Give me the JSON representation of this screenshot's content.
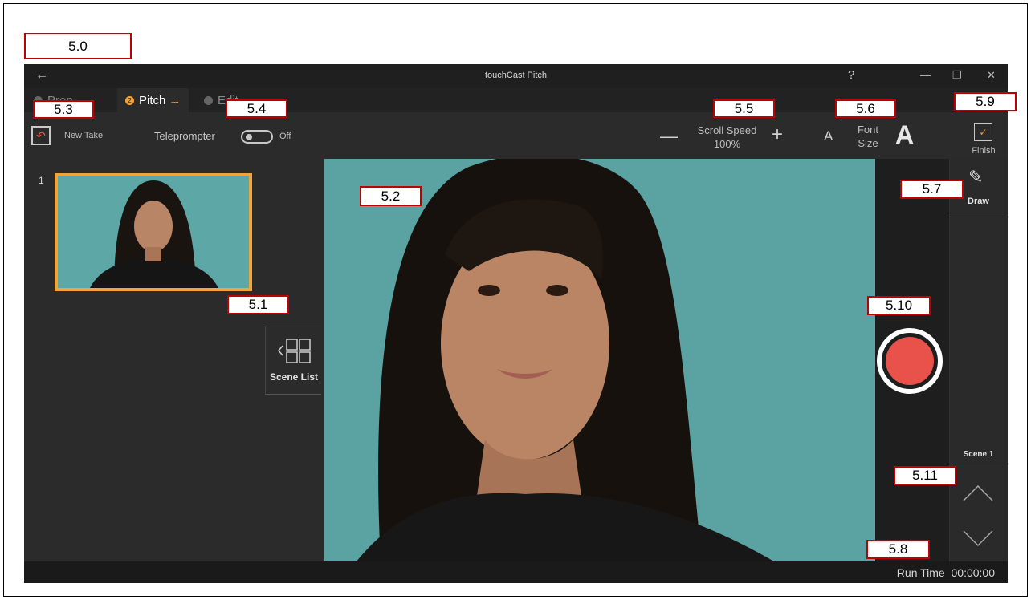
{
  "window": {
    "title": "touchCast Pitch",
    "help_label": "?",
    "back_icon": "back-arrow-icon"
  },
  "steps": [
    {
      "index": "1",
      "label": "Prep",
      "arrow": "→"
    },
    {
      "index": "2",
      "label": "Pitch",
      "arrow": "→"
    },
    {
      "index": "3",
      "label": "Edit",
      "arrow": ""
    }
  ],
  "toolbar": {
    "new_take_label": "New Take",
    "teleprompter_label": "Teleprompter",
    "teleprompter_state": "Off",
    "minus_label": "—",
    "scroll_speed_label": "Scroll Speed",
    "scroll_speed_value": "100%",
    "plus_label": "+",
    "font_small_label": "A",
    "font_size_line1": "Font",
    "font_size_line2": "Size",
    "font_large_label": "A",
    "finish_label": "Finish"
  },
  "scenes": {
    "items": [
      {
        "number": "1"
      }
    ],
    "scene_list_label": "Scene List"
  },
  "right_panel": {
    "draw_label": "Draw",
    "scene_label": "Scene 1"
  },
  "status": {
    "run_time_label": "Run Time",
    "run_time_value": "00:00:00"
  },
  "callouts": {
    "c50": "5.0",
    "c51": "5.1",
    "c52": "5.2",
    "c53": "5.3",
    "c54": "5.4",
    "c55": "5.5",
    "c56": "5.6",
    "c57": "5.7",
    "c58": "5.8",
    "c59": "5.9",
    "c510": "5.10",
    "c511": "5.11"
  },
  "colors": {
    "accent": "#f2a33a",
    "record": "#e8524a",
    "callout_border": "#c00000",
    "backdrop": "#5aa3a2"
  }
}
